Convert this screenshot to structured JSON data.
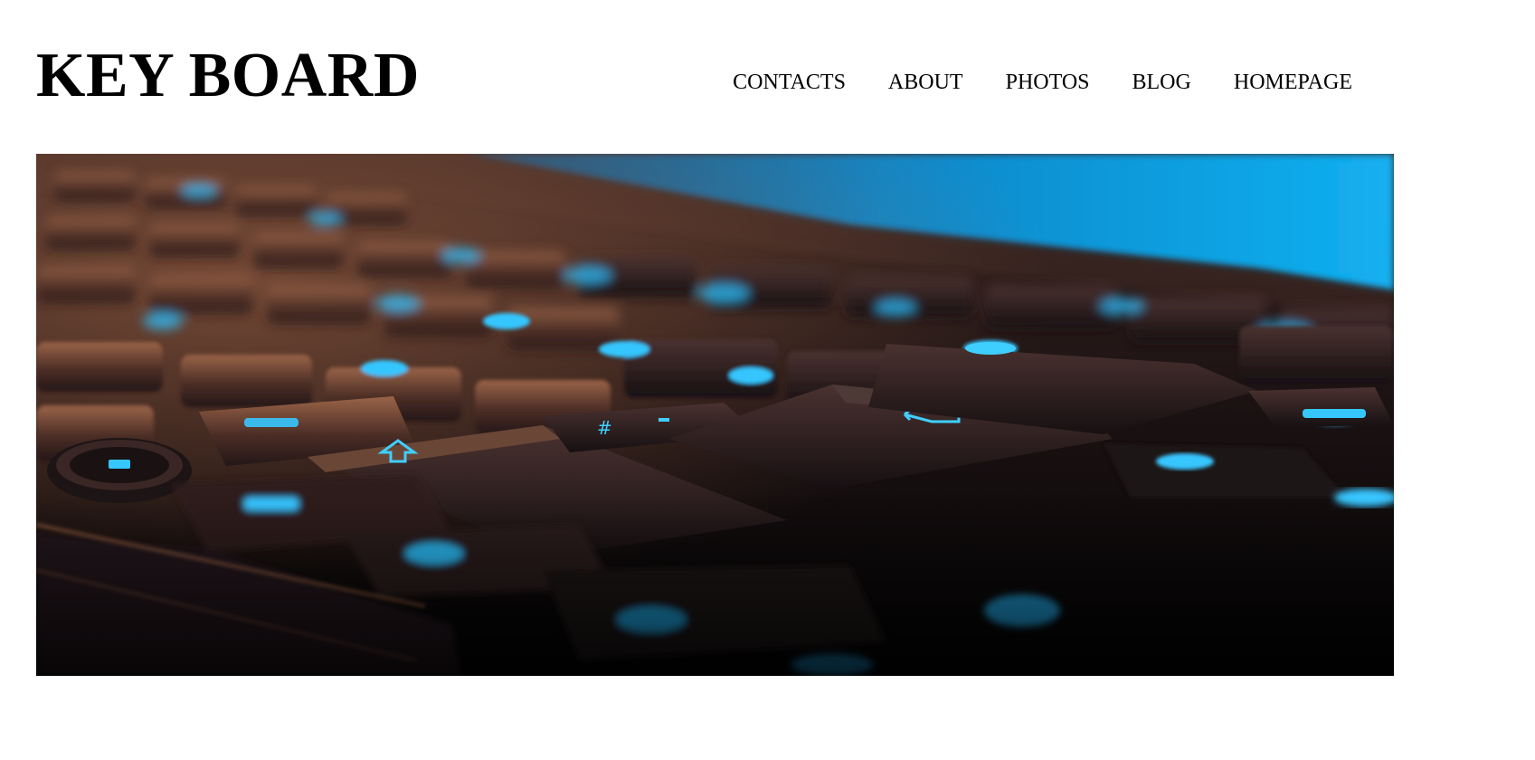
{
  "header": {
    "site_title": "KEY BOARD"
  },
  "nav": {
    "items": [
      {
        "label": "CONTACTS"
      },
      {
        "label": "ABOUT"
      },
      {
        "label": "PHOTOS"
      },
      {
        "label": "BLOG"
      },
      {
        "label": "HOMEPAGE"
      }
    ]
  },
  "hero": {
    "subject": "backlit-keyboard-photo",
    "colors": {
      "backlight": "#19b9f4",
      "key_warm": "#8a5a40",
      "key_dark": "#1b1416",
      "background": "#07080c"
    }
  }
}
